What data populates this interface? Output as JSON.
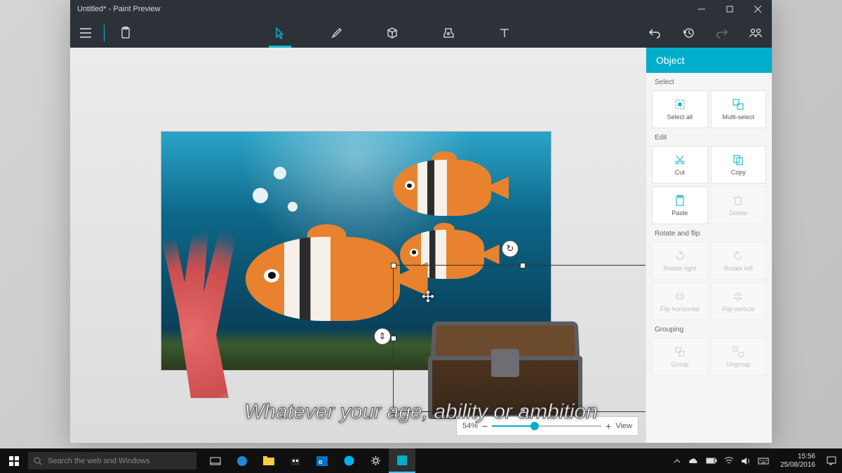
{
  "window": {
    "title": "Untitled* - Paint Preview"
  },
  "tools": {
    "select": "select",
    "brush": "brush",
    "cube": "3d-objects",
    "stamp": "stickers",
    "text": "text"
  },
  "panel": {
    "header": "Object",
    "sections": {
      "select": {
        "label": "Select",
        "select_all": "Select all",
        "multi_select": "Multi-select"
      },
      "edit": {
        "label": "Edit",
        "cut": "Cut",
        "copy": "Copy",
        "paste": "Paste",
        "delete": "Delete"
      },
      "rotate": {
        "label": "Rotate and flip",
        "rright": "Rotate right",
        "rleft": "Rotate left",
        "fliph": "Flip horizontal",
        "flipv": "Flip vertical"
      },
      "grouping": {
        "label": "Grouping",
        "group": "Group",
        "ungroup": "Ungroup"
      }
    }
  },
  "zoom": {
    "percent": "54%",
    "view": "View"
  },
  "caption": "Whatever your age, ability or ambition",
  "taskbar": {
    "search_placeholder": "Search the web and Windows",
    "time": "15:56",
    "date": "25/08/2016"
  }
}
